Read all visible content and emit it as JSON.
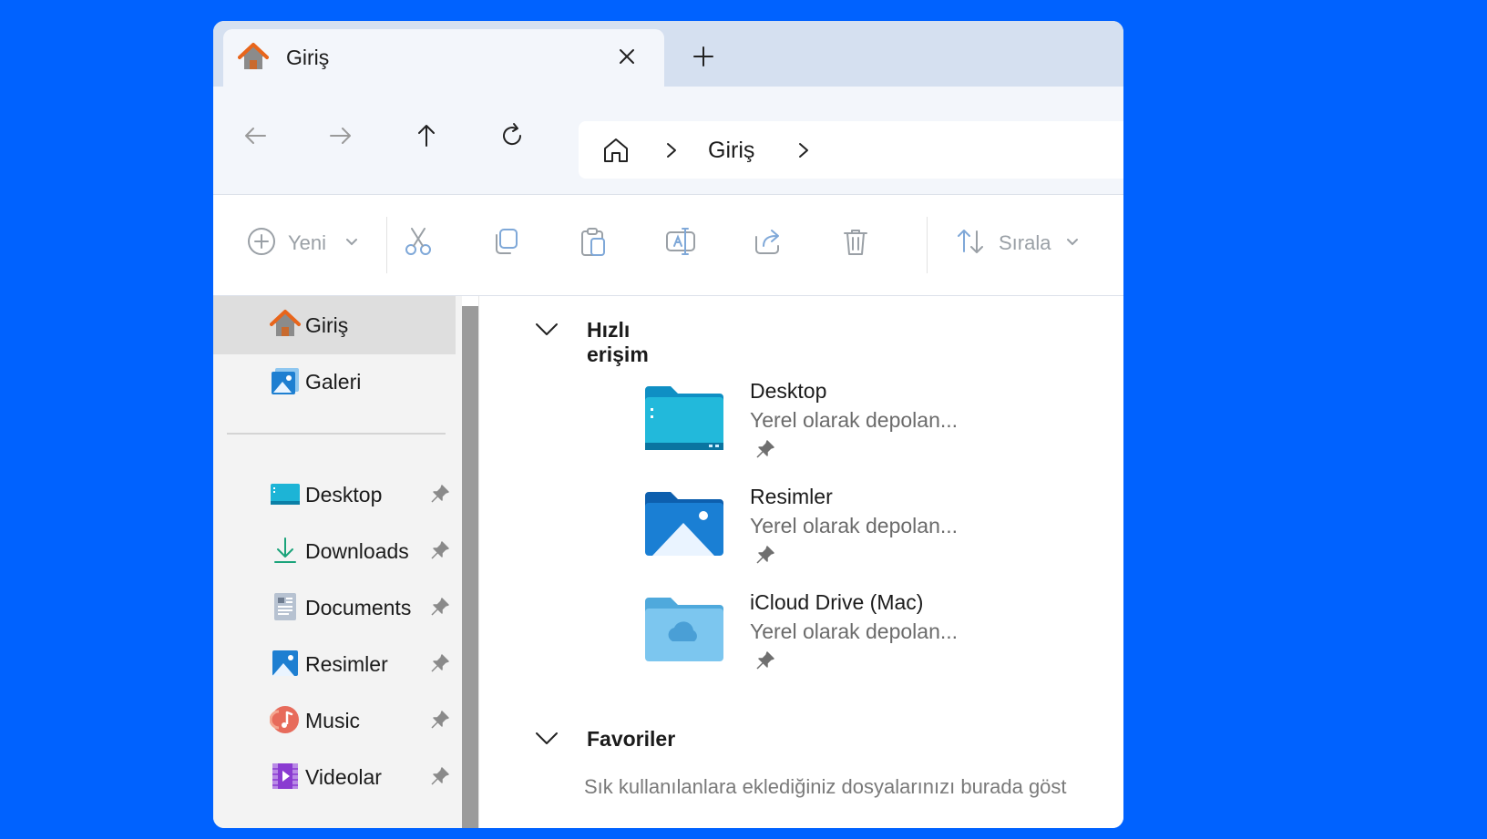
{
  "window": {
    "tab": {
      "title": "Giriş"
    },
    "address": {
      "crumb": "Giriş"
    }
  },
  "commandbar": {
    "new_label": "Yeni",
    "sort_label": "Sırala"
  },
  "sidebar": {
    "top_items": [
      {
        "label": "Giriş",
        "icon": "home-icon",
        "active": true
      },
      {
        "label": "Galeri",
        "icon": "gallery-icon",
        "active": false
      }
    ],
    "pinned_items": [
      {
        "label": "Desktop",
        "icon": "desktop-folder-icon"
      },
      {
        "label": "Downloads",
        "icon": "download-icon"
      },
      {
        "label": "Documents",
        "icon": "documents-icon"
      },
      {
        "label": "Resimler",
        "icon": "pictures-icon"
      },
      {
        "label": "Music",
        "icon": "music-icon"
      },
      {
        "label": "Videolar",
        "icon": "videos-icon"
      }
    ]
  },
  "main": {
    "quick_access": {
      "title": "Hızlı erişim",
      "items": [
        {
          "name": "Desktop",
          "desc": "Yerel olarak depolan...",
          "icon": "desktop-folder-icon"
        },
        {
          "name": "Resimler",
          "desc": "Yerel olarak depolan...",
          "icon": "pictures-folder-icon"
        },
        {
          "name": "iCloud Drive (Mac)",
          "desc": "Yerel olarak depolan...",
          "icon": "icloud-folder-icon"
        }
      ]
    },
    "favorites": {
      "title": "Favoriler",
      "empty_text": "Sık kullanılanlara eklediğiniz dosyalarınızı burada göst"
    }
  },
  "colors": {
    "background": "#0062ff",
    "tabstrip": "#d5e0f0",
    "navbar": "#f3f6fb",
    "sidebar": "#f3f3f3",
    "sidebar_active": "#dedede"
  }
}
